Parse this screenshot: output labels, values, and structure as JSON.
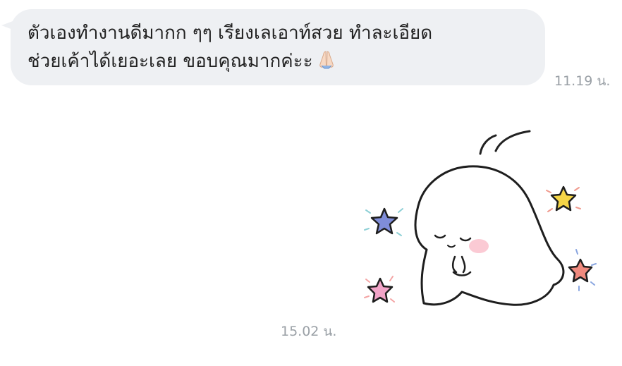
{
  "messages": [
    {
      "type": "text",
      "lines": [
        "ตัวเองทำงานดีมากก ๆๆ เรียงเลเอาท์สวย ทำละเอียด",
        "ช่วยเค้าได้เยอะเลย ขอบคุณมากค่ะะ"
      ],
      "emoji": "folded-hands",
      "time": "11.19 น."
    },
    {
      "type": "sticker",
      "sticker": "white-ghost-bowing-with-stars",
      "time": "15.02 น."
    }
  ],
  "colors": {
    "bubble_bg": "#eef0f3",
    "text": "#222222",
    "time": "#9aa0a6",
    "star_blue": "#7f8dd9",
    "star_yellow": "#f5d547",
    "star_coral": "#f08a7e",
    "star_pink": "#f2a4c8",
    "blush": "#f9b8c6"
  }
}
